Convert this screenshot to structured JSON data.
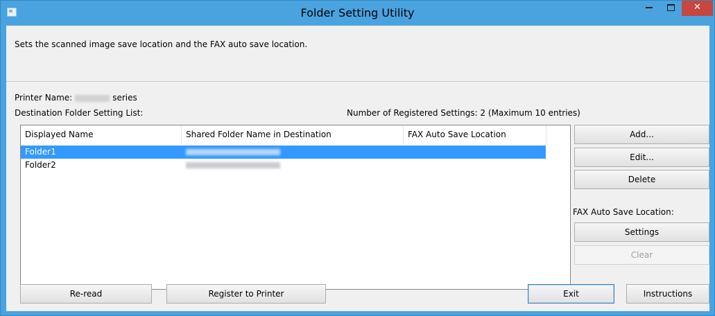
{
  "window": {
    "title": "Folder Setting Utility",
    "minimize_glyph": "",
    "close_glyph": "✕"
  },
  "description": "Sets the scanned image save location and the FAX auto save location.",
  "printer": {
    "label": "Printer Name:",
    "suffix": "series"
  },
  "destination_list": {
    "label": "Destination Folder Setting List:",
    "count_text": "Number of Registered Settings: 2 (Maximum 10 entries)",
    "columns": [
      "Displayed Name",
      "Shared Folder Name in Destination",
      "FAX Auto Save Location"
    ],
    "rows": [
      {
        "displayed_name": "Folder1",
        "selected": true
      },
      {
        "displayed_name": "Folder2",
        "selected": false
      }
    ]
  },
  "side_buttons": {
    "add": "Add...",
    "edit": "Edit...",
    "delete": "Delete",
    "fax_label": "FAX Auto Save Location:",
    "settings": "Settings",
    "clear": "Clear"
  },
  "bottom_buttons": {
    "reread": "Re-read",
    "register": "Register to Printer",
    "exit": "Exit",
    "instructions": "Instructions"
  },
  "colors": {
    "frame": "#4aa3df",
    "close": "#c7463e",
    "selection": "#3399ff"
  }
}
